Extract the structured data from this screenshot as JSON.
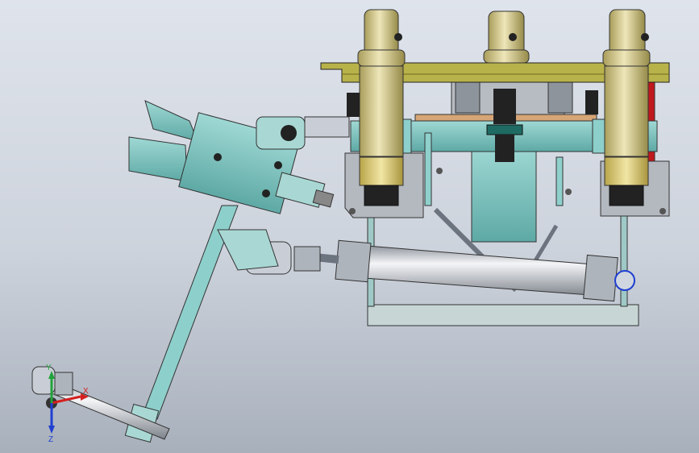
{
  "view": {
    "triad": {
      "x_label": "X",
      "y_label": "Y",
      "z_label": "Z",
      "x_color": "#d42020",
      "y_color": "#21a33a",
      "z_color": "#1f3fd1"
    },
    "colors": {
      "teal": "#7cc6c2",
      "teal_dark": "#3f8f8b",
      "brass": "#d8cf9a",
      "brass_dark": "#9b9050",
      "olive_bar": "#b8b24a",
      "steel": "#c9ced6",
      "steel_dark": "#6c7480",
      "frame_grey": "#aeb4bc",
      "copper": "#d7a676",
      "black": "#1b1b1b",
      "red": "#c0181d"
    }
  }
}
